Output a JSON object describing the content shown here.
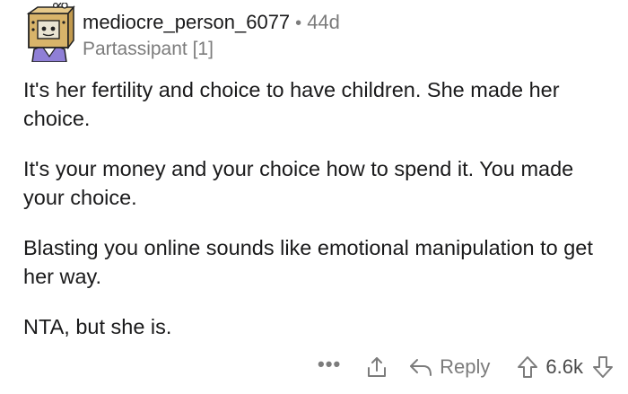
{
  "comment": {
    "username": "mediocre_person_6077",
    "separator": "•",
    "age": "44d",
    "flair": "Partassipant [1]",
    "paragraphs": [
      "It's her fertility and choice to have children. She made her choice.",
      "It's your money and your choice how to spend it. You made your choice.",
      "Blasting you online sounds like emotional manipulation to get her way.",
      "NTA, but she is."
    ]
  },
  "actions": {
    "more": "•••",
    "reply": "Reply",
    "score": "6.6k"
  },
  "icons": {
    "more": "more-options-icon",
    "share": "share-icon",
    "reply": "reply-arrow-icon",
    "upvote": "upvote-arrow-icon",
    "downvote": "downvote-arrow-icon"
  },
  "colors": {
    "text": "#1a1a1b",
    "muted": "#7c7c7c",
    "avatar_box": "#d8b46a"
  }
}
